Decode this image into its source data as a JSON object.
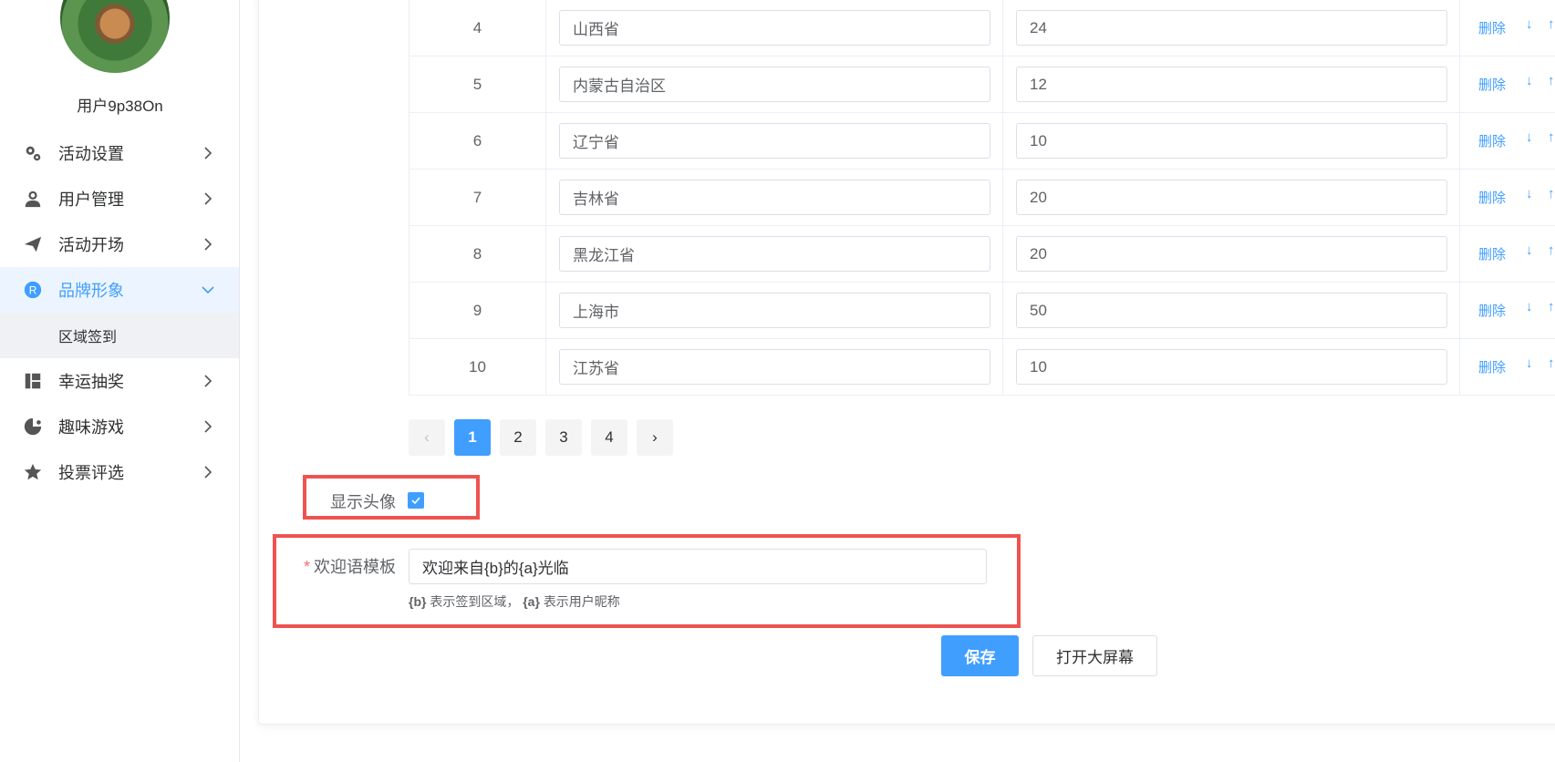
{
  "sidebar": {
    "username": "用户9p38On",
    "menu": [
      {
        "label": "活动设置",
        "icon": "gears-icon"
      },
      {
        "label": "用户管理",
        "icon": "user-manage-icon"
      },
      {
        "label": "活动开场",
        "icon": "paper-plane-icon"
      },
      {
        "label": "品牌形象",
        "icon": "registered-icon",
        "active": true,
        "sub": [
          "区域签到"
        ]
      },
      {
        "label": "幸运抽奖",
        "icon": "lottery-icon"
      },
      {
        "label": "趣味游戏",
        "icon": "game-icon"
      },
      {
        "label": "投票评选",
        "icon": "star-icon"
      }
    ]
  },
  "table": {
    "delete_label": "删除",
    "rows": [
      {
        "index": "4",
        "region": "山西省",
        "count": "24"
      },
      {
        "index": "5",
        "region": "内蒙古自治区",
        "count": "12"
      },
      {
        "index": "6",
        "region": "辽宁省",
        "count": "10"
      },
      {
        "index": "7",
        "region": "吉林省",
        "count": "20"
      },
      {
        "index": "8",
        "region": "黑龙江省",
        "count": "20"
      },
      {
        "index": "9",
        "region": "上海市",
        "count": "50"
      },
      {
        "index": "10",
        "region": "江苏省",
        "count": "10"
      }
    ]
  },
  "pagination": {
    "prev": "‹",
    "next": "›",
    "pages": [
      "1",
      "2",
      "3",
      "4"
    ],
    "current": "1"
  },
  "form": {
    "show_avatar_label": "显示头像",
    "show_avatar_checked": true,
    "welcome_label": "欢迎语模板",
    "required_mark": "*",
    "welcome_value": "欢迎来自{b}的{a}光临",
    "hint_b": "{b}",
    "hint_b_text": "表示签到区域，",
    "hint_a": "{a}",
    "hint_a_text": "表示用户昵称"
  },
  "buttons": {
    "save": "保存",
    "open_screen": "打开大屏幕"
  },
  "colors": {
    "primary": "#409eff",
    "highlight": "#ef5350",
    "required": "#f56c6c"
  }
}
